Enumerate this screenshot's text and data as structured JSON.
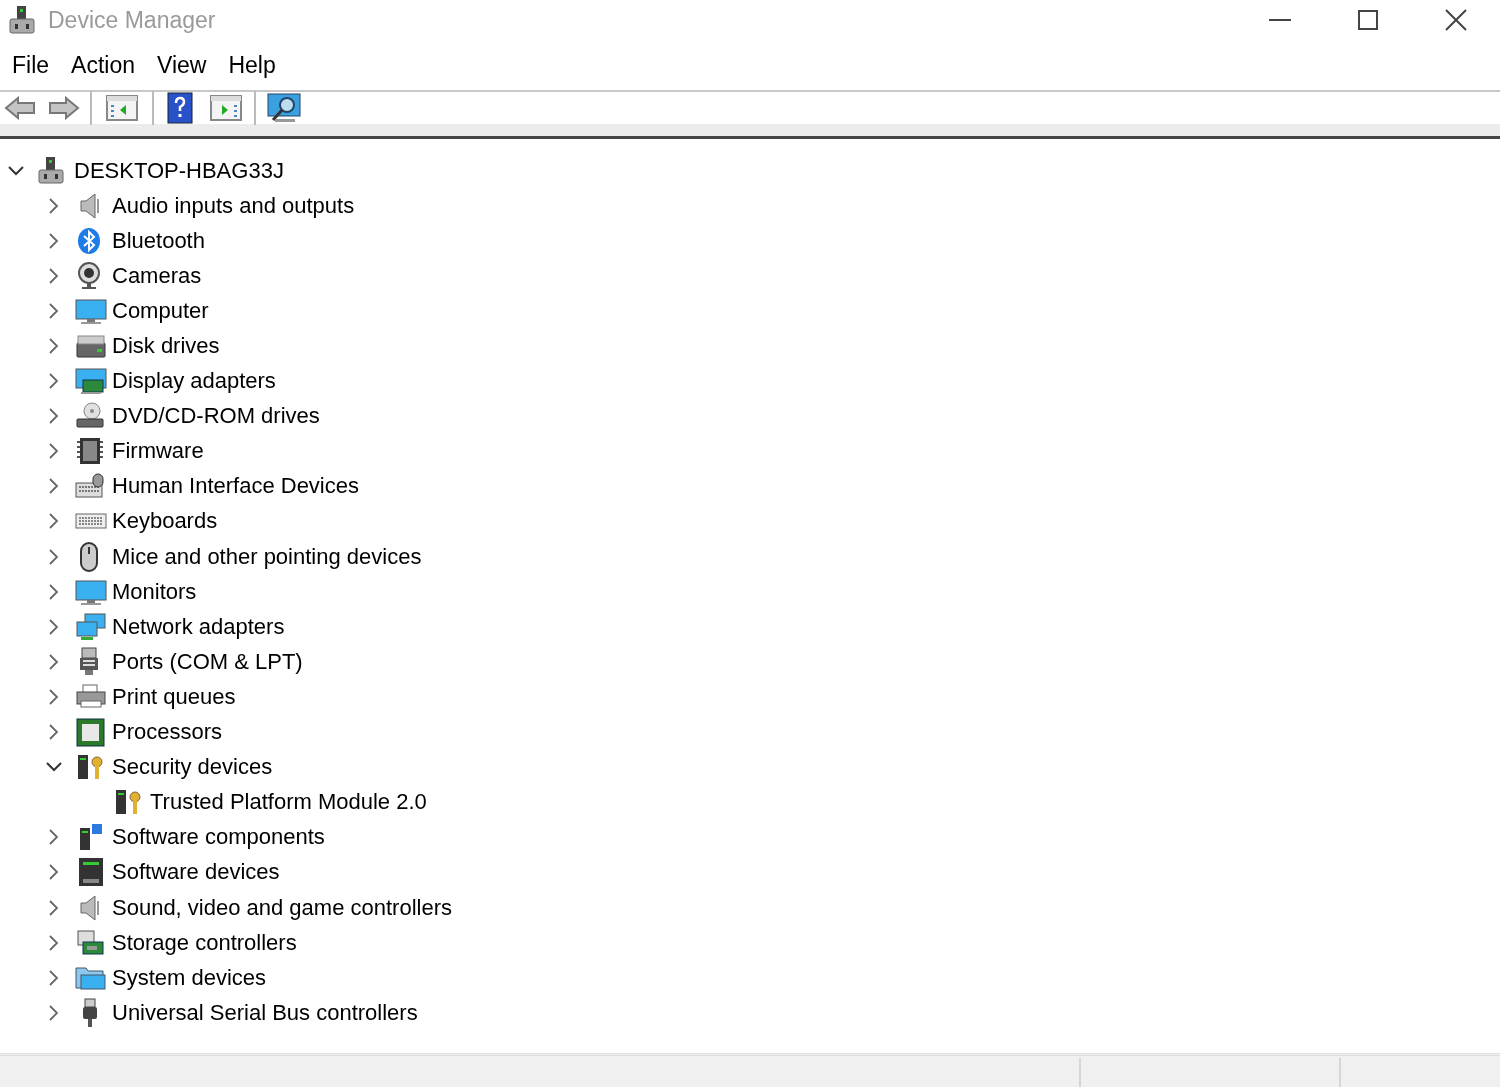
{
  "window": {
    "title": "Device Manager"
  },
  "menu": [
    "File",
    "Action",
    "View",
    "Help"
  ],
  "tree": {
    "label": "DESKTOP-HBAG33J",
    "kind": "computer-root",
    "expanded": true,
    "children": [
      {
        "label": "Audio inputs and outputs",
        "kind": "speaker",
        "expanded": false
      },
      {
        "label": "Bluetooth",
        "kind": "bluetooth",
        "expanded": false
      },
      {
        "label": "Cameras",
        "kind": "webcam",
        "expanded": false
      },
      {
        "label": "Computer",
        "kind": "monitor",
        "expanded": false
      },
      {
        "label": "Disk drives",
        "kind": "drive",
        "expanded": false
      },
      {
        "label": "Display adapters",
        "kind": "display-adapter",
        "expanded": false
      },
      {
        "label": "DVD/CD-ROM drives",
        "kind": "disc-drive",
        "expanded": false
      },
      {
        "label": "Firmware",
        "kind": "chip",
        "expanded": false
      },
      {
        "label": "Human Interface Devices",
        "kind": "hid",
        "expanded": false
      },
      {
        "label": "Keyboards",
        "kind": "keyboard",
        "expanded": false
      },
      {
        "label": "Mice and other pointing devices",
        "kind": "mouse",
        "expanded": false
      },
      {
        "label": "Monitors",
        "kind": "monitor",
        "expanded": false
      },
      {
        "label": "Network adapters",
        "kind": "network",
        "expanded": false
      },
      {
        "label": "Ports (COM & LPT)",
        "kind": "port",
        "expanded": false
      },
      {
        "label": "Print queues",
        "kind": "printer",
        "expanded": false
      },
      {
        "label": "Processors",
        "kind": "processor",
        "expanded": false
      },
      {
        "label": "Security devices",
        "kind": "security",
        "expanded": true,
        "children": [
          {
            "label": "Trusted Platform Module 2.0",
            "kind": "security"
          }
        ]
      },
      {
        "label": "Software components",
        "kind": "software-component",
        "expanded": false
      },
      {
        "label": "Software devices",
        "kind": "software-device",
        "expanded": false
      },
      {
        "label": "Sound, video and game controllers",
        "kind": "speaker",
        "expanded": false
      },
      {
        "label": "Storage controllers",
        "kind": "storage",
        "expanded": false
      },
      {
        "label": "System devices",
        "kind": "folder",
        "expanded": false
      },
      {
        "label": "Universal Serial Bus controllers",
        "kind": "usb",
        "expanded": false
      }
    ]
  }
}
